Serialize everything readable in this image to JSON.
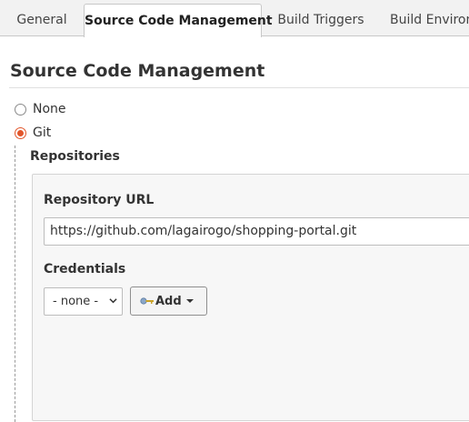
{
  "tabs": [
    {
      "label": "General",
      "active": false
    },
    {
      "label": "Source Code Management",
      "active": true
    },
    {
      "label": "Build Triggers",
      "active": false
    },
    {
      "label": "Build Environment",
      "active": false
    }
  ],
  "section": {
    "title": "Source Code Management"
  },
  "scm_options": [
    {
      "label": "None",
      "selected": false
    },
    {
      "label": "Git",
      "selected": true
    }
  ],
  "git": {
    "repositories_heading": "Repositories",
    "repository_url_label": "Repository URL",
    "repository_url_value": "https://github.com/lagairogo/shopping-portal.git",
    "credentials_label": "Credentials",
    "credentials_selected": "- none -",
    "add_button_label": "Add"
  },
  "colors": {
    "accent": "#e2562b",
    "tab_bar": "#f2f2f2",
    "panel": "#f7f7f7"
  },
  "icons": {
    "key": "key-icon",
    "dropdown": "chevron-down-icon",
    "caret": "caret-down-icon"
  }
}
